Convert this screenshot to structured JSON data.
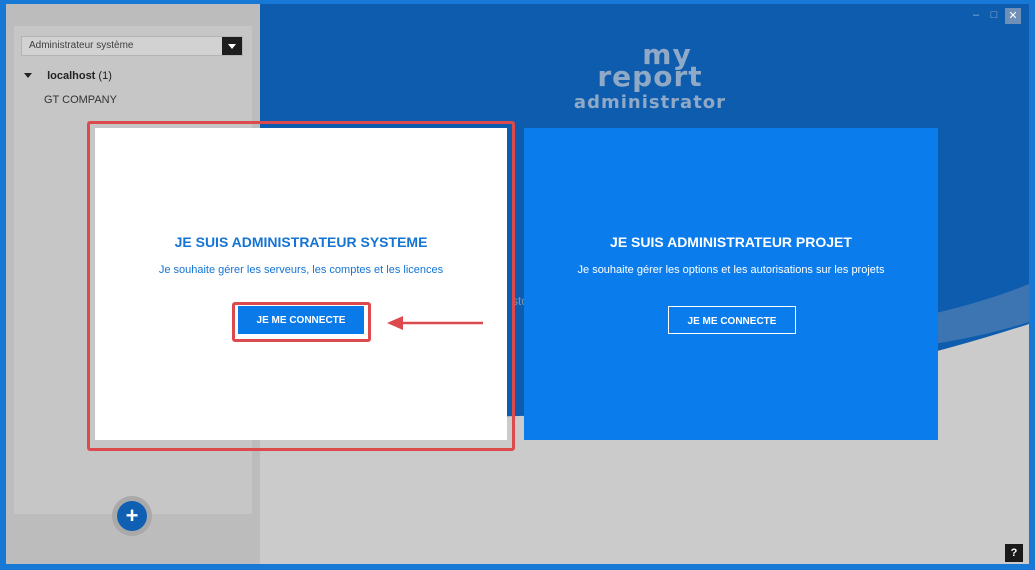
{
  "sidebar": {
    "role_select": {
      "value": "Administrateur système"
    },
    "tree": {
      "root_name": "localhost",
      "root_count": "(1)",
      "children": [
        "GT COMPANY"
      ]
    },
    "add_label": "+"
  },
  "window": {
    "logo": {
      "line1": "my",
      "line2": "report",
      "line3": "administrator"
    },
    "controls": {
      "minimize": "–",
      "maximize": "□",
      "close": "✕"
    },
    "help": "?",
    "ghost_text": "sto"
  },
  "cards": {
    "system": {
      "title": "JE SUIS ADMINISTRATEUR SYSTEME",
      "description": "Je souhaite gérer les serveurs, les comptes et les licences",
      "button": "JE ME CONNECTE"
    },
    "project": {
      "title": "JE SUIS ADMINISTRATEUR PROJET",
      "description": "Je souhaite gérer les options et les autorisations sur les projets",
      "button": "JE ME CONNECTE"
    }
  },
  "colors": {
    "accent": "#0a7ae8",
    "highlight": "#dd4a4d",
    "project_card": "#0b7cec"
  }
}
